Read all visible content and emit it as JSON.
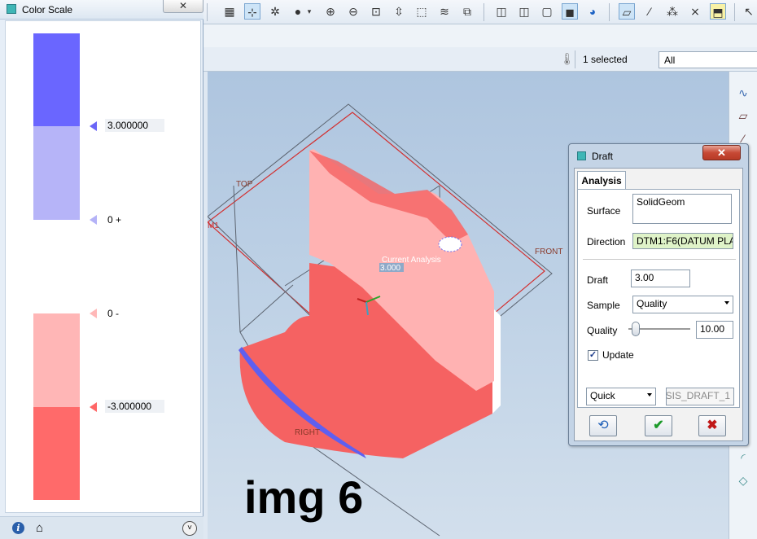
{
  "color_scale": {
    "title": "Color Scale",
    "close_label": "✕",
    "labels": [
      {
        "value": "3.000000",
        "color": "#6a66f7"
      },
      {
        "value": "0 +",
        "color": "#b4b2f7"
      },
      {
        "value": "0 -",
        "color": "#ffb8b8"
      },
      {
        "value": "-3.000000",
        "color": "#ff6666"
      }
    ],
    "bands": [
      "#6a66ff",
      "#b6b4f8",
      "#ffffff",
      "#ffb6b6",
      "#ff6a6a"
    ]
  },
  "selection": {
    "count_text": "1 selected",
    "filter_value": "All"
  },
  "viewport": {
    "datum_labels": {
      "top": "TOP",
      "front": "FRONT",
      "right": "RIGHT",
      "dtm1": "M1"
    },
    "analysis_label": "Current Analysis",
    "analysis_value": "3.000"
  },
  "watermark": "img 6",
  "draft_dialog": {
    "title": "Draft",
    "close_label": "✕",
    "tab_label": "Analysis",
    "surface_label": "Surface",
    "surface_value": "SolidGeom",
    "direction_label": "Direction",
    "direction_value": "DTM1:F6(DATUM PLA",
    "draft_label": "Draft",
    "draft_value": "3.00",
    "sample_label": "Sample",
    "sample_value": "Quality",
    "quality_label": "Quality",
    "quality_value": "10.00",
    "quality_level": 0.05,
    "update_label": "Update",
    "update_checked": true,
    "mode_value": "Quick",
    "name_value": "SIS_DRAFT_1"
  }
}
